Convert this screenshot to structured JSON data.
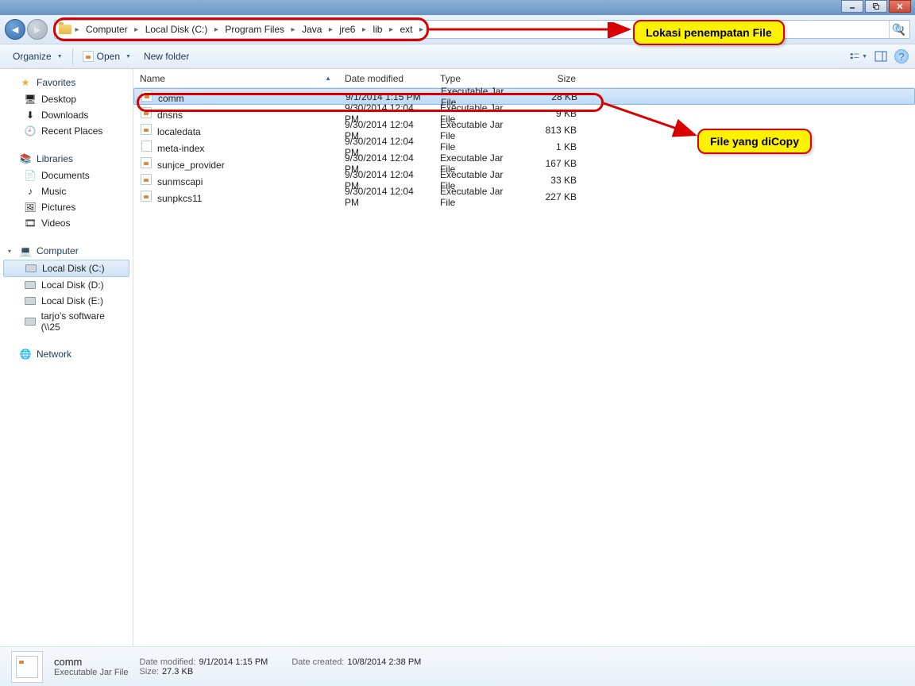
{
  "breadcrumb": [
    "Computer",
    "Local Disk (C:)",
    "Program Files",
    "Java",
    "jre6",
    "lib",
    "ext"
  ],
  "toolbar": {
    "organize": "Organize",
    "open": "Open",
    "newfolder": "New folder"
  },
  "sidebar": {
    "favorites": {
      "label": "Favorites",
      "items": [
        "Desktop",
        "Downloads",
        "Recent Places"
      ]
    },
    "libraries": {
      "label": "Libraries",
      "items": [
        "Documents",
        "Music",
        "Pictures",
        "Videos"
      ]
    },
    "computer": {
      "label": "Computer",
      "items": [
        "Local Disk (C:)",
        "Local Disk (D:)",
        "Local Disk (E:)",
        "tarjo's software (\\\\25"
      ]
    },
    "network": {
      "label": "Network"
    }
  },
  "columns": {
    "name": "Name",
    "date": "Date modified",
    "type": "Type",
    "size": "Size"
  },
  "files": [
    {
      "name": "comm",
      "date": "9/1/2014 1:15 PM",
      "type": "Executable Jar File",
      "size": "28 KB",
      "sel": true,
      "icon": "jar"
    },
    {
      "name": "dnsns",
      "date": "9/30/2014 12:04 PM",
      "type": "Executable Jar File",
      "size": "9 KB",
      "icon": "jar"
    },
    {
      "name": "localedata",
      "date": "9/30/2014 12:04 PM",
      "type": "Executable Jar File",
      "size": "813 KB",
      "icon": "jar"
    },
    {
      "name": "meta-index",
      "date": "9/30/2014 12:04 PM",
      "type": "File",
      "size": "1 KB",
      "icon": "file"
    },
    {
      "name": "sunjce_provider",
      "date": "9/30/2014 12:04 PM",
      "type": "Executable Jar File",
      "size": "167 KB",
      "icon": "jar"
    },
    {
      "name": "sunmscapi",
      "date": "9/30/2014 12:04 PM",
      "type": "Executable Jar File",
      "size": "33 KB",
      "icon": "jar"
    },
    {
      "name": "sunpkcs11",
      "date": "9/30/2014 12:04 PM",
      "type": "Executable Jar File",
      "size": "227 KB",
      "icon": "jar"
    }
  ],
  "details": {
    "name": "comm",
    "type": "Executable Jar File",
    "labels": {
      "dm": "Date modified:",
      "size": "Size:",
      "dc": "Date created:"
    },
    "date_modified": "9/1/2014 1:15 PM",
    "size": "27.3 KB",
    "date_created": "10/8/2014 2:38 PM"
  },
  "callouts": {
    "location": "Lokasi penempatan File",
    "copyfile": "File yang diCopy"
  }
}
